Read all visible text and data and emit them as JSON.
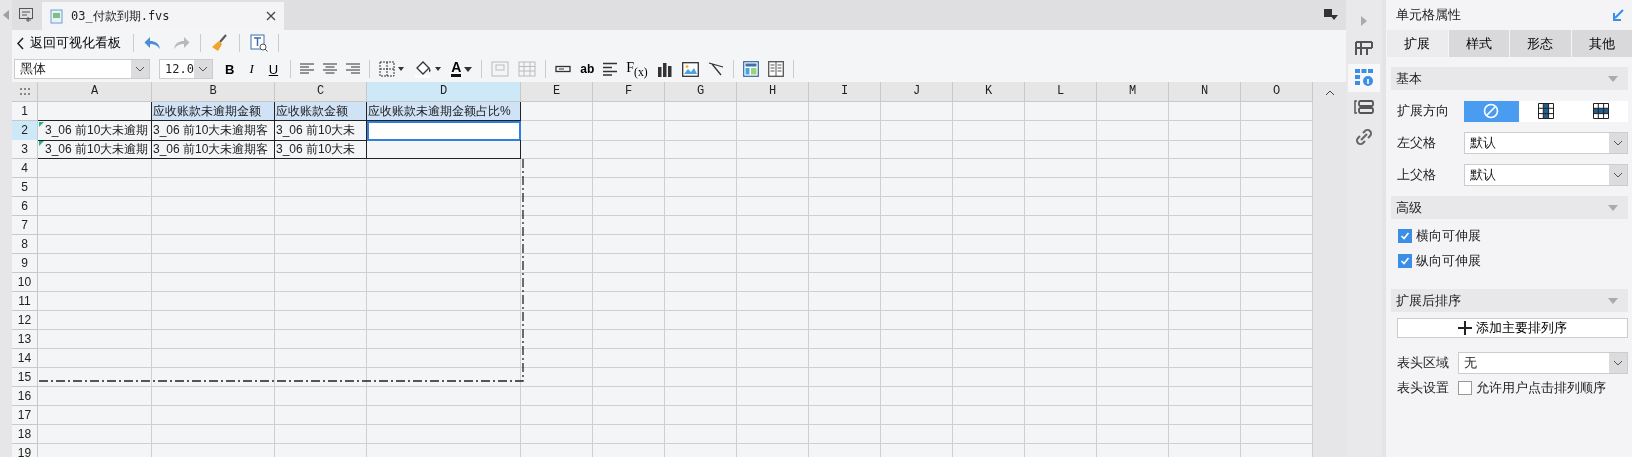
{
  "file_tab": {
    "label": "03_付款到期.fvs",
    "selected": true
  },
  "toolbar": {
    "back": "返回可视化看板",
    "font": "黑体",
    "size": "12.0",
    "format": [
      {
        "kind": "bold",
        "label": "B"
      },
      {
        "kind": "italic",
        "label": "I"
      },
      {
        "kind": "underline",
        "label": "U"
      }
    ],
    "font_color": "A",
    "text_widget": "ab",
    "formula": "F$_{(x)}$"
  },
  "grid": {
    "columns": [
      {
        "label": "A",
        "selected": false
      },
      {
        "label": "B",
        "selected": false
      },
      {
        "label": "C",
        "selected": false
      },
      {
        "label": "D",
        "selected": true
      },
      {
        "label": "E",
        "selected": false
      },
      {
        "label": "F",
        "selected": false
      },
      {
        "label": "G",
        "selected": false
      },
      {
        "label": "H",
        "selected": false
      },
      {
        "label": "I",
        "selected": false
      },
      {
        "label": "J",
        "selected": false
      },
      {
        "label": "K",
        "selected": false
      },
      {
        "label": "L",
        "selected": false
      },
      {
        "label": "M",
        "selected": false
      },
      {
        "label": "N",
        "selected": false
      },
      {
        "label": "O",
        "selected": false
      }
    ],
    "rows": [
      {
        "label": "1",
        "selected": false,
        "cells": [
          {
            "kind": "blank",
            "selected": false
          },
          {
            "kind": "header",
            "text": "应收账款未逾期金额",
            "selected": false
          },
          {
            "kind": "header",
            "text": "应收账款金额",
            "selected": false
          },
          {
            "kind": "header",
            "text": "应收账款未逾期金额占比%",
            "selected": false
          }
        ]
      },
      {
        "label": "2",
        "selected": true,
        "cells": [
          {
            "kind": "data",
            "text": "3_06 前10大未逾期",
            "marker": true,
            "selected": false
          },
          {
            "kind": "data",
            "text": "3_06 前10大未逾期客",
            "selected": false
          },
          {
            "kind": "data",
            "text": "3_06 前10大未",
            "selected": false
          },
          {
            "kind": "blank",
            "selected": true
          }
        ]
      },
      {
        "label": "3",
        "selected": false,
        "cells": [
          {
            "kind": "data",
            "text": "3_06 前10大未逾期",
            "marker": true,
            "selected": false
          },
          {
            "kind": "data",
            "text": "3_06 前10大未逾期客",
            "selected": false
          },
          {
            "kind": "data",
            "text": "3_06 前10大未",
            "selected": false
          },
          {
            "kind": "blank",
            "selected": false
          }
        ]
      },
      {
        "label": "4",
        "selected": false
      },
      {
        "label": "5",
        "selected": false
      },
      {
        "label": "6",
        "selected": false
      },
      {
        "label": "7",
        "selected": false
      },
      {
        "label": "8",
        "selected": false
      },
      {
        "label": "9",
        "selected": false
      },
      {
        "label": "10",
        "selected": false
      },
      {
        "label": "11",
        "selected": false
      },
      {
        "label": "12",
        "selected": false
      },
      {
        "label": "13",
        "selected": false
      },
      {
        "label": "14",
        "selected": false
      },
      {
        "label": "15",
        "selected": false
      },
      {
        "label": "16",
        "selected": false
      },
      {
        "label": "17",
        "selected": false
      },
      {
        "label": "18",
        "selected": false
      },
      {
        "label": "19",
        "selected": false
      }
    ]
  },
  "panel": {
    "title": "单元格属性",
    "tabs": [
      {
        "label": "扩展",
        "selected": true
      },
      {
        "label": "样式",
        "selected": false
      },
      {
        "label": "形态",
        "selected": false
      },
      {
        "label": "其他",
        "selected": false
      }
    ],
    "basic": {
      "title": "基本",
      "direction_label": "扩展方向",
      "directions": [
        {
          "kind": "none",
          "selected": true
        },
        {
          "kind": "vertical",
          "selected": false
        },
        {
          "kind": "horizontal",
          "selected": false
        }
      ],
      "fields": [
        {
          "label": "左父格",
          "value": "默认"
        },
        {
          "label": "上父格",
          "value": "默认"
        }
      ]
    },
    "advanced": {
      "title": "高级",
      "options": [
        {
          "label": "横向可伸展",
          "checked": true
        },
        {
          "label": "纵向可伸展",
          "checked": true
        }
      ]
    },
    "sorting": {
      "title": "扩展后排序",
      "add_button": "添加主要排列序",
      "header_area": {
        "label": "表头区域",
        "value": "无"
      },
      "header_setting": {
        "label": "表头设置",
        "option": "允许用户点击排列顺序",
        "checked": false
      }
    }
  }
}
